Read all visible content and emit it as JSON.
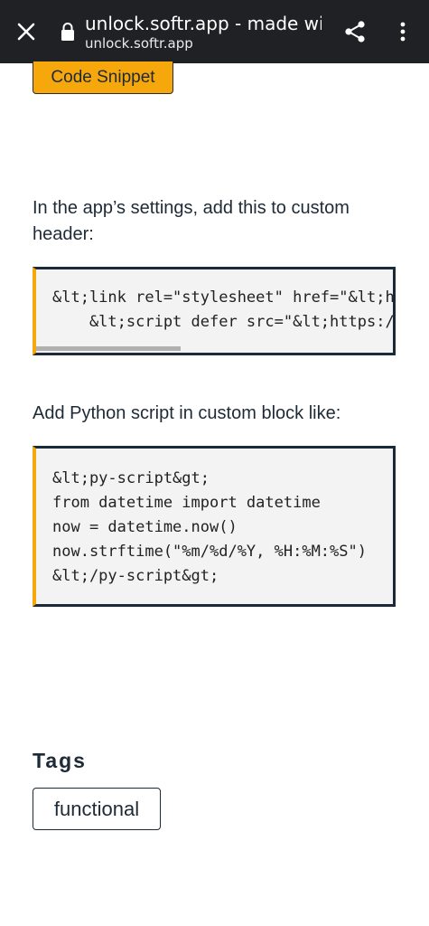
{
  "browser": {
    "title": "unlock.softr.app - made wit...",
    "domain": "unlock.softr.app",
    "icons": {
      "close": "close-icon",
      "lock": "lock-icon",
      "share": "share-icon",
      "menu": "more-vert-icon"
    }
  },
  "content": {
    "snippet_button_label": "Code Snippet",
    "instruction_header": "In the app’s settings, add this to custom header:",
    "header_code": [
      "&lt;link rel=\"stylesheet\" href=\"&lt;h",
      "    &lt;script defer src=\"&lt;https:/"
    ],
    "instruction_block": "Add Python script in custom block like:",
    "block_code": [
      "&lt;py-script&gt;",
      "from datetime import datetime",
      "now = datetime.now()",
      "now.strftime(\"%m/%d/%Y, %H:%M:%S\")",
      "&lt;/py-script&gt;"
    ],
    "tags_heading": "Tags",
    "tags": [
      "functional"
    ]
  },
  "colors": {
    "topbar": "#202124",
    "accent": "#f5a70c",
    "code_border": "#1b2a3a",
    "text": "#1e2a36"
  }
}
